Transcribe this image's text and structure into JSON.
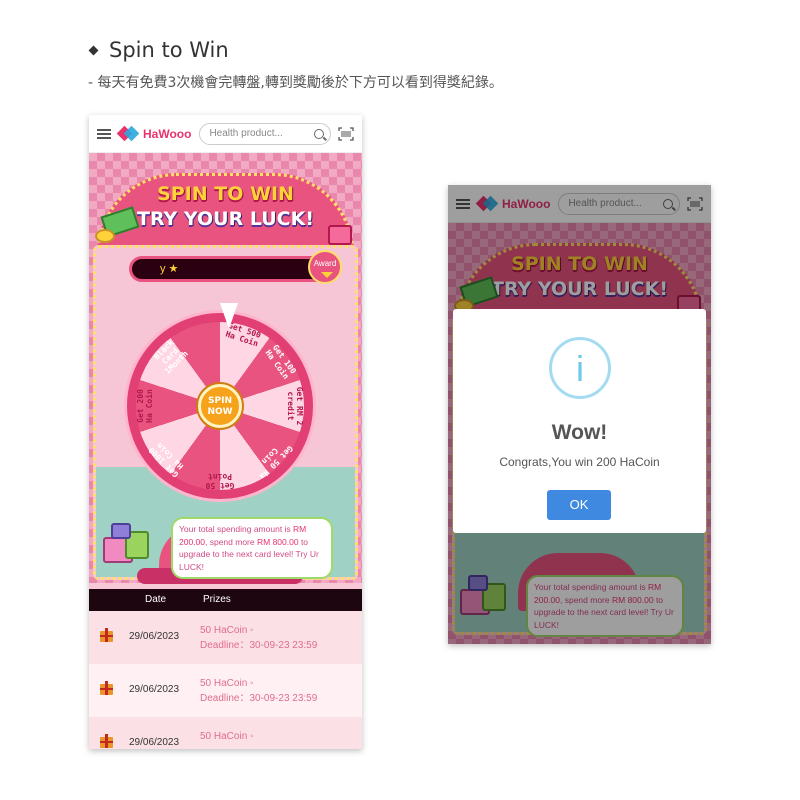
{
  "header": {
    "title": "Spin to Win",
    "subtitle": "- 每天有免費3次機會完轉盤,轉到獎勵後於下方可以看到得獎紀錄。"
  },
  "app": {
    "logo_text": "HaWooo",
    "search_placeholder": "Health product..."
  },
  "banner": {
    "title_line1": "SPIN TO WIN",
    "title_line2": "TRY YOUR LUCK!",
    "marquee_text": "y ★",
    "award_label": "Award"
  },
  "wheel": {
    "segments": [
      "Get 500 Ha Coin",
      "Get 100 Ha Coin",
      "Get RM 2 credit",
      "Get 50 Ha Coin",
      "Get 50 Point",
      "Get 1000 Ha Coin",
      "Get 200 Ha Coin",
      "Black Card 1Month"
    ],
    "spin_label": "SPIN NOW"
  },
  "spending_message": {
    "prefix": "Your total spending amount is ",
    "amount": "RM 200.00",
    "middle": ", spend more ",
    "needed": "RM 800.00",
    "suffix": " to upgrade to the next card level! Try Ur LUCK!"
  },
  "history": {
    "columns": [
      "Date",
      "Prizes"
    ],
    "rows": [
      {
        "date": "29/06/2023",
        "prize": "50 HaCoin ◦",
        "deadline": "Deadline：30-09-23 23:59"
      },
      {
        "date": "29/06/2023",
        "prize": "50 HaCoin ◦",
        "deadline": "Deadline：30-09-23 23:59"
      },
      {
        "date": "29/06/2023",
        "prize": "50 HaCoin ◦",
        "deadline": ""
      }
    ]
  },
  "modal": {
    "icon": "info-icon",
    "icon_glyph": "i",
    "title": "Wow!",
    "message": "Congrats,You win 200 HaCoin",
    "ok_label": "OK"
  },
  "colors": {
    "brand_pink": "#e8336d",
    "wheel_pink": "#e9537f",
    "ok_blue": "#3f8ae0",
    "info_blue": "#a5dbf1"
  }
}
